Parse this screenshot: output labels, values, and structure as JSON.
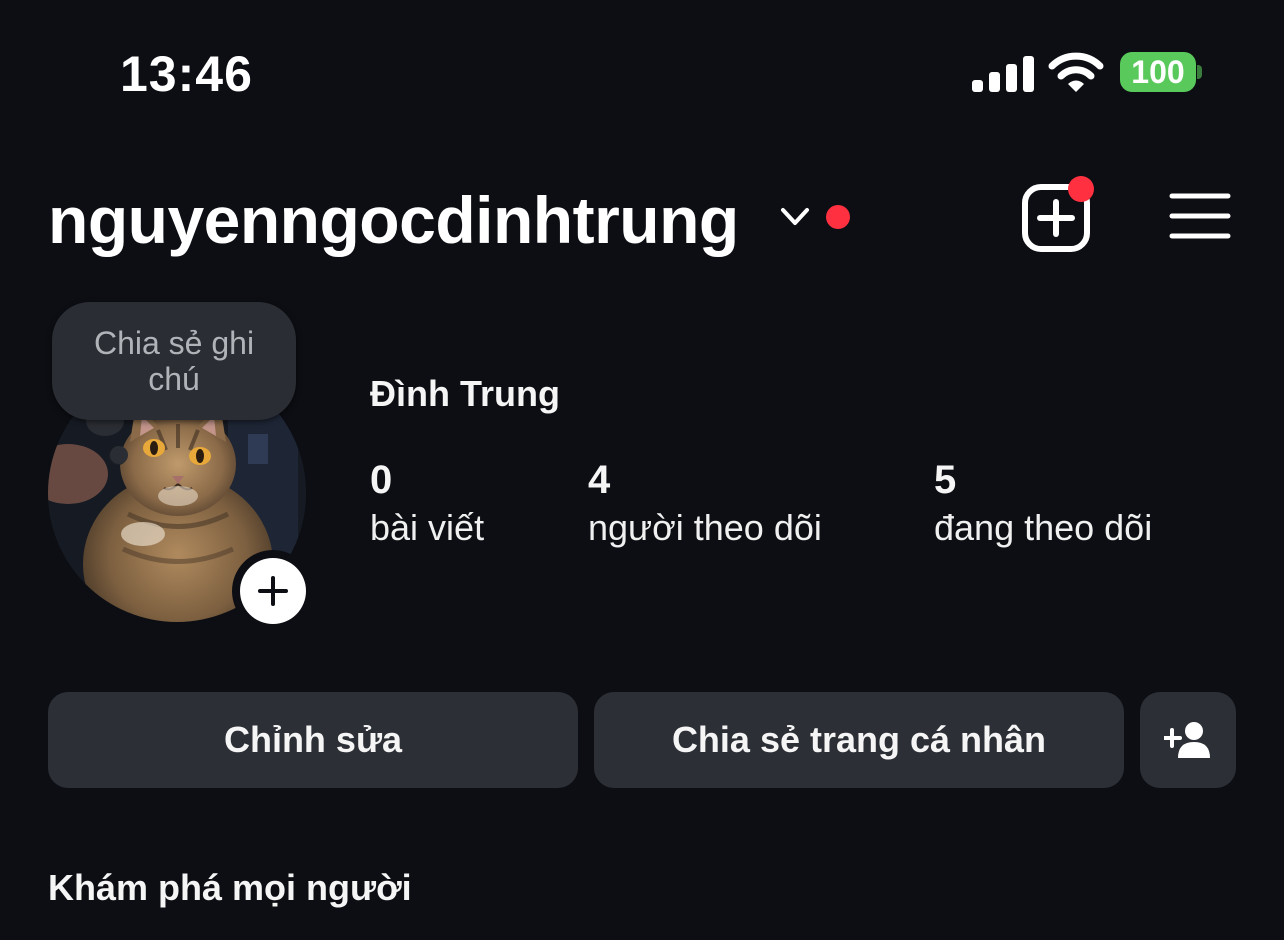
{
  "status_bar": {
    "time": "13:46",
    "battery": "100",
    "icons": [
      "cellular-signal-icon",
      "wifi-icon",
      "battery-icon"
    ]
  },
  "header": {
    "username": "nguyenngocdinhtrung",
    "icons": [
      "chevron-down-icon",
      "notification-dot",
      "add-post-icon",
      "menu-icon"
    ],
    "accent_color": "#ff3040"
  },
  "profile": {
    "note_placeholder": "Chia sẻ ghi chú",
    "display_name": "Đình Trung",
    "stats": [
      {
        "value": "0",
        "label": "bài viết"
      },
      {
        "value": "4",
        "label": "người theo dõi"
      },
      {
        "value": "5",
        "label": "đang theo dõi"
      }
    ]
  },
  "actions": {
    "edit_label": "Chỉnh sửa",
    "share_label": "Chia sẻ trang cá nhân",
    "add_user_icon": "person-add-icon"
  },
  "discover": {
    "title": "Khám phá mọi người"
  },
  "colors": {
    "background": "#0c0e13",
    "button_bg": "#2c2f35",
    "battery": "#5ac95c"
  }
}
